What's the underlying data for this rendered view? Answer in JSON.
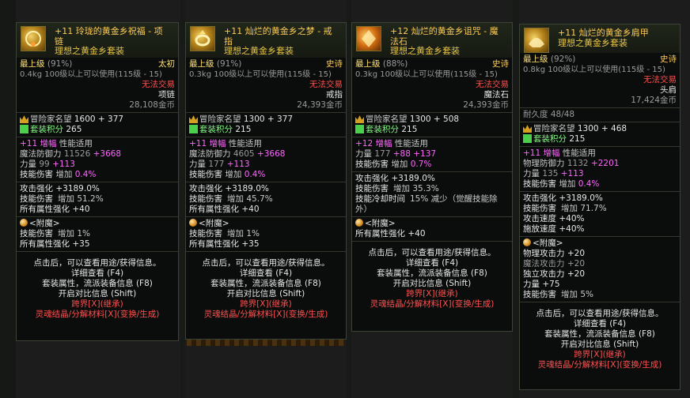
{
  "cards": [
    {
      "title_line1": "+11 玲珑的黄金乡祝福 - 项",
      "title_line2": "链",
      "set_name": "理想之黄金乡套装",
      "level_label": "最上级",
      "level_pct": "(91%)",
      "rarity": "太初",
      "weight_req": "0.4kg  100级以上可以使用(115级 - 15)",
      "trade": "无法交易",
      "slot": "项链",
      "price": "28,108金币",
      "fame_label": "冒险家名望",
      "fame_value": "1600 + 377",
      "setpts_label": "套装积分",
      "setpts_value": "265",
      "amp_prefix": "+11",
      "amp_label": "增幅",
      "amp_suffix": "性能适用",
      "def_label": "魔法防御力",
      "def_base": "11526",
      "def_bonus": "+3668",
      "stat_label": "力量",
      "stat_base": "99",
      "stat_bonus": "+113",
      "skill_label": "技能伤害",
      "skill_text": "增加",
      "skill_val": "0.4%",
      "a1": "攻击强化 +3189.0%",
      "a2l": "技能伤害",
      "a2r": "增加 51.2%",
      "a3": "所有属性强化 +40",
      "ench_label": "<附魔>",
      "e1l": "技能伤害",
      "e1r": "增加 1%",
      "e2": "所有属性强化 +35",
      "f1": "点击后，可以查看用途/获得信息。",
      "f2": "详细查看 (F4)",
      "f3": "套装属性，流派装备信息 (F8)",
      "f4": "开启对比信息 (Shift)",
      "f5": "跨界[X](继承)",
      "f6": "灵魂结晶/分解材料[X](变换/生成)"
    },
    {
      "title_line1": "+11 灿烂的黄金乡之梦 - 戒",
      "title_line2": "指",
      "set_name": "理想之黄金乡套装",
      "level_label": "最上级",
      "level_pct": "(91%)",
      "rarity": "史诗",
      "weight_req": "0.3kg  100级以上可以使用(115级 - 15)",
      "trade": "无法交易",
      "slot": "戒指",
      "price": "24,393金币",
      "fame_label": "冒险家名望",
      "fame_value": "1300 + 377",
      "setpts_label": "套装积分",
      "setpts_value": "215",
      "amp_prefix": "+11",
      "amp_label": "增幅",
      "amp_suffix": "性能适用",
      "def_label": "魔法防御力",
      "def_base": "4605",
      "def_bonus": "+3668",
      "stat_label": "力量",
      "stat_base": "177",
      "stat_bonus": "+113",
      "skill_label": "技能伤害",
      "skill_text": "增加",
      "skill_val": "0.4%",
      "a1": "攻击强化 +3189.0%",
      "a2l": "技能伤害",
      "a2r": "增加 45.7%",
      "a3": "所有属性强化 +40",
      "ench_label": "<附魔>",
      "e1l": "技能伤害",
      "e1r": "增加 1%",
      "e2": "所有属性强化 +35",
      "f1": "点击后，可以查看用途/获得信息。",
      "f2": "详细查看 (F4)",
      "f3": "套装属性，流派装备信息 (F8)",
      "f4": "开启对比信息 (Shift)",
      "f5": "跨界[X](继承)",
      "f6": "灵魂结晶/分解材料[X](变换/生成)"
    },
    {
      "title_line1": "+12 灿烂的黄金乡诅咒 - 魔",
      "title_line2": "法石",
      "set_name": "理想之黄金乡套装",
      "level_label": "最上级",
      "level_pct": "(88%)",
      "rarity": "史诗",
      "weight_req": "0.3kg  100级以上可以使用(115级 - 15)",
      "trade": "无法交易",
      "slot": "魔法石",
      "price": "24,393金币",
      "fame_label": "冒险家名望",
      "fame_value": "1300 + 508",
      "setpts_label": "套装积分",
      "setpts_value": "215",
      "amp_prefix": "+12",
      "amp_label": "增幅",
      "amp_suffix": "性能适用",
      "stat_label": "力量",
      "stat_base": "177",
      "stat_bonus": "+88 +137",
      "skill_label": "技能伤害",
      "skill_text": "增加",
      "skill_val": "0.7%",
      "a1": "攻击强化 +3189.0%",
      "a2l": "技能伤害",
      "a2r": "增加 35.3%",
      "a3l": "技能冷却时间",
      "a3r": "15% 减少（觉醒技能除",
      "a3r2": "外）",
      "ench_label": "<附魔>",
      "e2": "所有属性强化 +40",
      "f1": "点击后，可以查看用途/获得信息。",
      "f2": "详细查看 (F4)",
      "f3": "套装属性，流派装备信息 (F8)",
      "f4": "开启对比信息 (Shift)",
      "f5": "跨界[X](继承)",
      "f6": "灵魂结晶/分解材料[X](变换/生成)"
    },
    {
      "title_line1": "+11 灿烂的黄金乡肩甲",
      "set_name": "理想之黄金乡套装",
      "level_label": "最上级",
      "level_pct": "(92%)",
      "rarity": "史诗",
      "weight_req": "0.8kg  100级以上可以使用(115级 - 15)",
      "trade": "无法交易",
      "slot": "头肩",
      "price": "17,424金币",
      "durability": "耐久度 48/48",
      "fame_label": "冒险家名望",
      "fame_value": "1300 + 468",
      "setpts_label": "套装积分",
      "setpts_value": "215",
      "amp_prefix": "+11",
      "amp_label": "增幅",
      "amp_suffix": "性能适用",
      "def_label": "物理防御力",
      "def_base": "1132",
      "def_bonus": "+2201",
      "stat_label": "力量",
      "stat_base": "135",
      "stat_bonus": "+113",
      "skill_label": "技能伤害",
      "skill_text": "增加",
      "skill_val": "0.4%",
      "a1": "攻击强化 +3189.0%",
      "a2l": "技能伤害",
      "a2r": "增加 71.7%",
      "a3": "攻击速度 +40%",
      "a4": "施放速度 +40%",
      "ench_label": "<附魔>",
      "m1": "物理攻击力 +20",
      "m2": "魔法攻击力 +20",
      "m3": "独立攻击力 +20",
      "m4": "力量 +75",
      "m5l": "技能伤害",
      "m5r": "增加 5%",
      "f1": "点击后，可以查看用途/获得信息。",
      "f2": "详细查看 (F4)",
      "f3": "套装属性，流派装备信息 (F8)",
      "f4": "开启对比信息 (Shift)",
      "f5": "跨界[X](继承)",
      "f6": "灵魂结晶/分解材料[X](变换/生成)"
    }
  ],
  "colors": {
    "title": "#ffcc55",
    "amp": "#ff66ff",
    "bonus": "#ff66ff",
    "trade": "#ff5050",
    "grade_primal": "#ffe070",
    "grade_epic": "#ffcc55"
  },
  "icons": [
    "necklace-icon",
    "ring-icon",
    "magic-stone-icon",
    "shoulder-icon",
    "fame-crown-icon",
    "set-points-icon",
    "enchant-orb-icon"
  ]
}
